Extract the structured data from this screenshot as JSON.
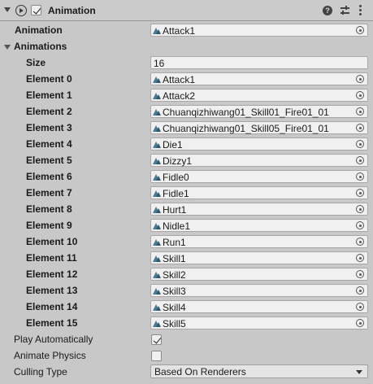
{
  "component": {
    "title": "Animation",
    "enabled": true,
    "help_icon": "help-icon",
    "preset_icon": "preset-icon",
    "menu_icon": "kebab-menu-icon"
  },
  "fields": {
    "animation_label": "Animation",
    "animation_value": "Attack1",
    "animations_label": "Animations",
    "size_label": "Size",
    "size_value": "16",
    "elements": [
      {
        "label": "Element 0",
        "value": "Attack1"
      },
      {
        "label": "Element 1",
        "value": "Attack2"
      },
      {
        "label": "Element 2",
        "value": "Chuanqizhiwang01_Skill01_Fire01_01"
      },
      {
        "label": "Element 3",
        "value": "Chuanqizhiwang01_Skill05_Fire01_01"
      },
      {
        "label": "Element 4",
        "value": "Die1"
      },
      {
        "label": "Element 5",
        "value": "Dizzy1"
      },
      {
        "label": "Element 6",
        "value": "Fidle0"
      },
      {
        "label": "Element 7",
        "value": "Fidle1"
      },
      {
        "label": "Element 8",
        "value": "Hurt1"
      },
      {
        "label": "Element 9",
        "value": "Nidle1"
      },
      {
        "label": "Element 10",
        "value": "Run1"
      },
      {
        "label": "Element 11",
        "value": "Skill1"
      },
      {
        "label": "Element 12",
        "value": "Skill2"
      },
      {
        "label": "Element 13",
        "value": "Skill3"
      },
      {
        "label": "Element 14",
        "value": "Skill4"
      },
      {
        "label": "Element 15",
        "value": "Skill5"
      }
    ],
    "play_auto_label": "Play Automatically",
    "play_auto_checked": true,
    "animate_physics_label": "Animate Physics",
    "animate_physics_checked": false,
    "culling_label": "Culling Type",
    "culling_value": "Based On Renderers"
  }
}
